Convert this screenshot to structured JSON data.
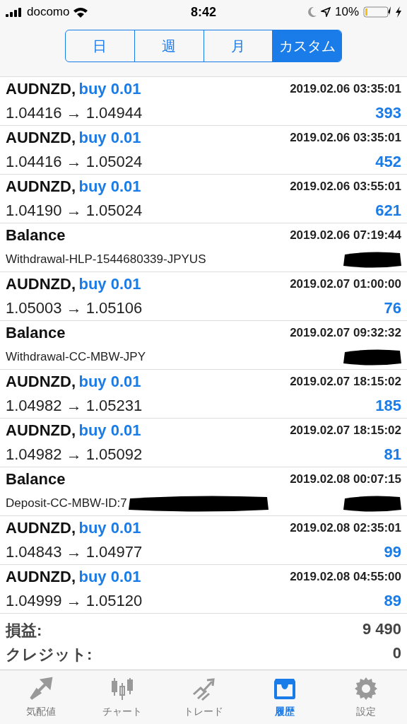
{
  "status_bar": {
    "carrier": "docomo",
    "time": "8:42",
    "battery": "10%"
  },
  "period_tabs": [
    {
      "label": "日",
      "selected": false
    },
    {
      "label": "週",
      "selected": false
    },
    {
      "label": "月",
      "selected": false
    },
    {
      "label": "カスタム",
      "selected": true
    }
  ],
  "history": [
    {
      "kind": "trade",
      "symbol": "AUDNZD,",
      "action": "buy 0.01",
      "time": "2019.02.06 03:35:01",
      "prices": "1.04416 → 1.04944",
      "profit": "393"
    },
    {
      "kind": "trade",
      "symbol": "AUDNZD,",
      "action": "buy 0.01",
      "time": "2019.02.06 03:35:01",
      "prices": "1.04416 → 1.05024",
      "profit": "452"
    },
    {
      "kind": "trade",
      "symbol": "AUDNZD,",
      "action": "buy 0.01",
      "time": "2019.02.06 03:55:01",
      "prices": "1.04190 → 1.05024",
      "profit": "621"
    },
    {
      "kind": "balance",
      "title": "Balance",
      "time": "2019.02.06 07:19:44",
      "comment": "Withdrawal-HLP-1544680339-JPYUS",
      "comment_redacted": false
    },
    {
      "kind": "trade",
      "symbol": "AUDNZD,",
      "action": "buy 0.01",
      "time": "2019.02.07 01:00:00",
      "prices": "1.05003 → 1.05106",
      "profit": "76"
    },
    {
      "kind": "balance",
      "title": "Balance",
      "time": "2019.02.07 09:32:32",
      "comment": "Withdrawal-CC-MBW-JPY",
      "comment_redacted": false
    },
    {
      "kind": "trade",
      "symbol": "AUDNZD,",
      "action": "buy 0.01",
      "time": "2019.02.07 18:15:02",
      "prices": "1.04982 → 1.05231",
      "profit": "185"
    },
    {
      "kind": "trade",
      "symbol": "AUDNZD,",
      "action": "buy 0.01",
      "time": "2019.02.07 18:15:02",
      "prices": "1.04982 → 1.05092",
      "profit": "81"
    },
    {
      "kind": "balance",
      "title": "Balance",
      "time": "2019.02.08 00:07:15",
      "comment": "Deposit-CC-MBW-ID:7",
      "comment_redacted": true
    },
    {
      "kind": "trade",
      "symbol": "AUDNZD,",
      "action": "buy 0.01",
      "time": "2019.02.08 02:35:01",
      "prices": "1.04843 → 1.04977",
      "profit": "99"
    },
    {
      "kind": "trade",
      "symbol": "AUDNZD,",
      "action": "buy 0.01",
      "time": "2019.02.08 04:55:00",
      "prices": "1.04999 → 1.05120",
      "profit": "89"
    }
  ],
  "summary": [
    {
      "label": "損益:",
      "value": "9 490"
    },
    {
      "label": "クレジット:",
      "value": "0"
    }
  ],
  "tab_bar": [
    {
      "kind": "quotes",
      "label": "気配値",
      "selected": false
    },
    {
      "kind": "chart",
      "label": "チャート",
      "selected": false
    },
    {
      "kind": "trade",
      "label": "トレード",
      "selected": false
    },
    {
      "kind": "history",
      "label": "履歴",
      "selected": true
    },
    {
      "kind": "settings",
      "label": "設定",
      "selected": false
    }
  ]
}
